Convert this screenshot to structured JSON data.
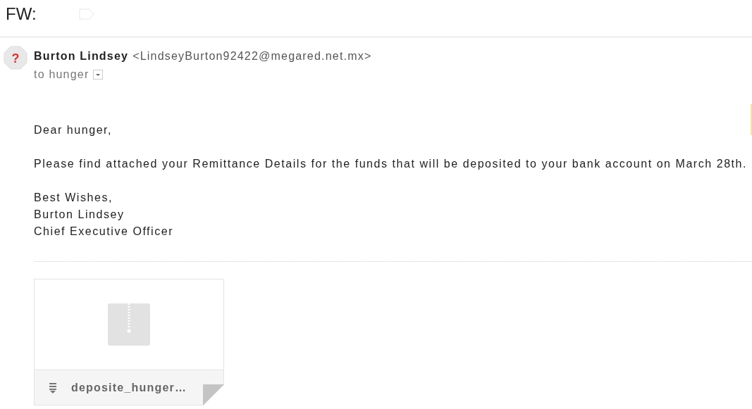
{
  "subject": "FW:",
  "sender": {
    "avatar_glyph": "?",
    "name": "Burton Lindsey",
    "email": "<LindseyBurton92422@megared.net.mx>",
    "recipient": "to hunger"
  },
  "body": [
    "Dear hunger,",
    "Please find attached your Remittance Details for the funds that will be deposited to your bank account on March 28th.",
    "Best Wishes,\nBurton Lindsey\nChief Executive Officer"
  ],
  "attachment": {
    "name": "deposite_hunger…"
  }
}
